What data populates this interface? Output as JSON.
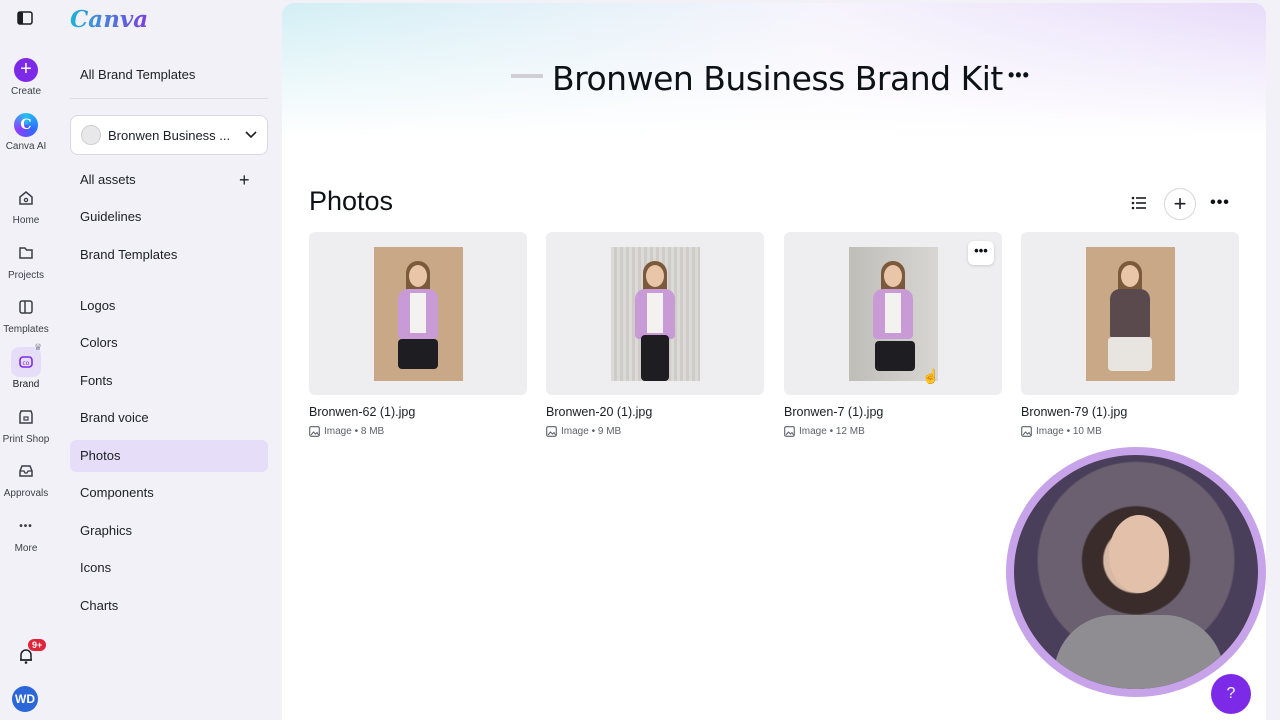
{
  "rail": {
    "items": [
      {
        "label": "Create",
        "icon": "plus-icon"
      },
      {
        "label": "Canva AI",
        "icon": "canva-ai-icon"
      },
      {
        "label": "Home",
        "icon": "home-icon"
      },
      {
        "label": "Projects",
        "icon": "folder-icon"
      },
      {
        "label": "Templates",
        "icon": "templates-icon"
      },
      {
        "label": "Brand",
        "icon": "brand-icon"
      },
      {
        "label": "Print Shop",
        "icon": "print-shop-icon"
      },
      {
        "label": "Approvals",
        "icon": "approvals-icon"
      },
      {
        "label": "More",
        "icon": "more-icon"
      }
    ],
    "notification_badge": "9+",
    "avatar_initials": "WD"
  },
  "panel": {
    "logo": "Canva",
    "all_brand_templates": "All Brand Templates",
    "kit_select": "Bronwen Business ...",
    "links_top": [
      "All assets",
      "Guidelines",
      "Brand Templates"
    ],
    "links_assets": [
      "Logos",
      "Colors",
      "Fonts",
      "Brand voice",
      "Photos",
      "Components",
      "Graphics",
      "Icons",
      "Charts"
    ],
    "active": "Photos"
  },
  "main": {
    "kit_title": "Bronwen Business Brand Kit",
    "section_title": "Photos",
    "photos": [
      {
        "name": "Bronwen-62 (1).jpg",
        "meta": "Image • 8 MB"
      },
      {
        "name": "Bronwen-20 (1).jpg",
        "meta": "Image • 9 MB"
      },
      {
        "name": "Bronwen-7 (1).jpg",
        "meta": "Image • 12 MB"
      },
      {
        "name": "Bronwen-79 (1).jpg",
        "meta": "Image • 10 MB"
      }
    ]
  },
  "help_label": "?",
  "colors": {
    "accent": "#7d2ae8",
    "active_bg": "#e6def8",
    "webcam_border": "#c7a3ea"
  }
}
